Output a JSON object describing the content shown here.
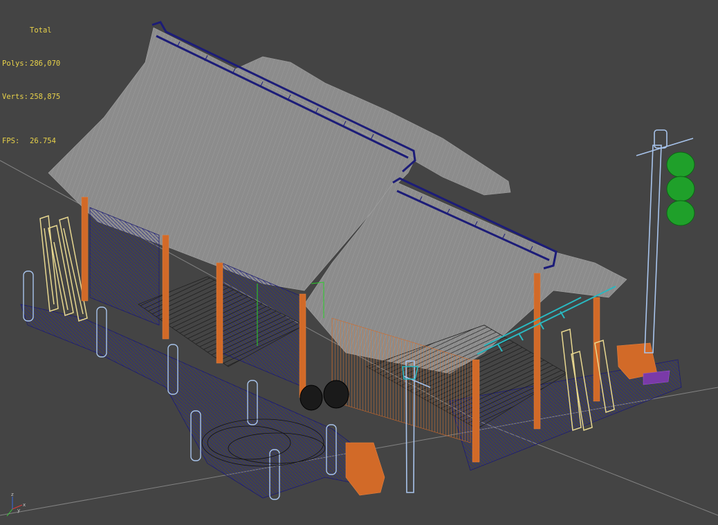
{
  "viewport": {
    "stats": {
      "title": "Total",
      "polys_label": "Polys:",
      "polys_value": "286,070",
      "verts_label": "Verts:",
      "verts_value": "258,875",
      "fps_label": "FPS:",
      "fps_value": "26.754"
    },
    "axis": {
      "z_label": "z",
      "x_label": "x",
      "y_label": "y"
    }
  },
  "colors": {
    "background": "#444444",
    "grid_line": "#8a8a8a",
    "thatch": "#8c8c8c",
    "wireframe_navy": "#1c1c70",
    "wood_orange": "#d26a28",
    "light_blue": "#a8c4ec",
    "cream": "#e8d890",
    "teal": "#2ab8c0",
    "green": "#1fa02a",
    "stats_text": "#e8d24a"
  }
}
